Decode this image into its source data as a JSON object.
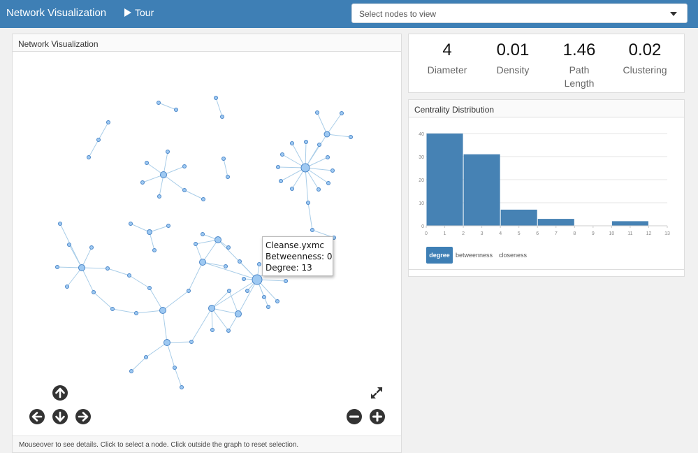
{
  "navbar": {
    "brand": "Network Visualization",
    "tour_label": "Tour",
    "select_placeholder": "Select nodes to view"
  },
  "network_panel": {
    "title": "Network Visualization",
    "footer": "Mouseover to see details. Click to select a node. Click outside the graph to reset selection.",
    "tooltip": {
      "name": "Cleanse.yxmc",
      "betweenness": "Betweenness: 0",
      "degree": "Degree: 13"
    }
  },
  "stats": [
    {
      "value": "4",
      "label": "Diameter"
    },
    {
      "value": "0.01",
      "label": "Density"
    },
    {
      "value": "1.46",
      "label": "Path Length"
    },
    {
      "value": "0.02",
      "label": "Clustering"
    }
  ],
  "centrality_panel": {
    "title": "Centrality Distribution",
    "tabs": [
      "degree",
      "betweenness",
      "closeness"
    ],
    "active_tab": "degree"
  },
  "colors": {
    "navbar": "#3e7fb5",
    "bar": "#4682b4",
    "node_fill": "#9ec9f2",
    "node_stroke": "#4a86c8",
    "edge": "#a9cde8"
  },
  "icons": [
    "play-icon",
    "caret-down-icon",
    "arrow-up-icon",
    "arrow-left-icon",
    "arrow-down-icon",
    "arrow-right-icon",
    "expand-icon",
    "zoom-out-icon",
    "zoom-in-icon"
  ],
  "chart_data": {
    "type": "bar",
    "bins": [
      [
        0,
        2
      ],
      [
        2,
        4
      ],
      [
        4,
        6
      ],
      [
        6,
        8
      ],
      [
        8,
        10
      ],
      [
        10,
        12
      ]
    ],
    "values": [
      40,
      31,
      7,
      3,
      0,
      2
    ],
    "x_ticks": [
      0,
      1,
      2,
      3,
      4,
      5,
      6,
      7,
      8,
      9,
      10,
      11,
      12,
      13
    ],
    "y_ticks": [
      0,
      10,
      20,
      30,
      40
    ],
    "xlim": [
      0,
      13
    ],
    "ylim": [
      0,
      40
    ],
    "xlabel": "",
    "ylabel": "",
    "grid": "horizontal"
  }
}
